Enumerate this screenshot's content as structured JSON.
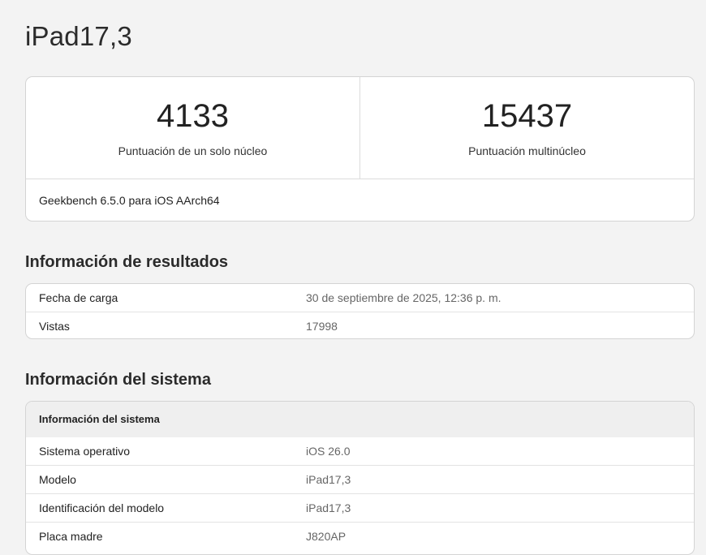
{
  "page": {
    "title": "iPad17,3"
  },
  "scores": {
    "single_core": {
      "value": "4133",
      "label": "Puntuación de un solo núcleo"
    },
    "multi_core": {
      "value": "15437",
      "label": "Puntuación multinúcleo"
    },
    "version": "Geekbench 6.5.0 para iOS AArch64"
  },
  "results_info": {
    "heading": "Información de resultados",
    "rows": [
      {
        "key": "Fecha de carga",
        "value": "30 de septiembre de 2025, 12:36 p. m."
      },
      {
        "key": "Vistas",
        "value": "17998"
      }
    ]
  },
  "system_info": {
    "heading": "Información del sistema",
    "table_header": "Información del sistema",
    "rows": [
      {
        "key": "Sistema operativo",
        "value": "iOS 26.0"
      },
      {
        "key": "Modelo",
        "value": "iPad17,3"
      },
      {
        "key": "Identificación del modelo",
        "value": "iPad17,3"
      },
      {
        "key": "Placa madre",
        "value": "J820AP"
      }
    ]
  }
}
